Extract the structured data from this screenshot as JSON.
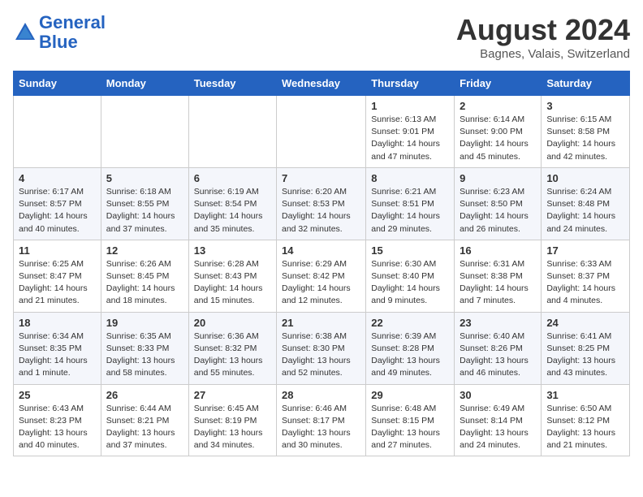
{
  "header": {
    "logo_line1": "General",
    "logo_line2": "Blue",
    "month": "August 2024",
    "location": "Bagnes, Valais, Switzerland"
  },
  "days_of_week": [
    "Sunday",
    "Monday",
    "Tuesday",
    "Wednesday",
    "Thursday",
    "Friday",
    "Saturday"
  ],
  "weeks": [
    [
      {
        "day": "",
        "info": ""
      },
      {
        "day": "",
        "info": ""
      },
      {
        "day": "",
        "info": ""
      },
      {
        "day": "",
        "info": ""
      },
      {
        "day": "1",
        "info": "Sunrise: 6:13 AM\nSunset: 9:01 PM\nDaylight: 14 hours\nand 47 minutes."
      },
      {
        "day": "2",
        "info": "Sunrise: 6:14 AM\nSunset: 9:00 PM\nDaylight: 14 hours\nand 45 minutes."
      },
      {
        "day": "3",
        "info": "Sunrise: 6:15 AM\nSunset: 8:58 PM\nDaylight: 14 hours\nand 42 minutes."
      }
    ],
    [
      {
        "day": "4",
        "info": "Sunrise: 6:17 AM\nSunset: 8:57 PM\nDaylight: 14 hours\nand 40 minutes."
      },
      {
        "day": "5",
        "info": "Sunrise: 6:18 AM\nSunset: 8:55 PM\nDaylight: 14 hours\nand 37 minutes."
      },
      {
        "day": "6",
        "info": "Sunrise: 6:19 AM\nSunset: 8:54 PM\nDaylight: 14 hours\nand 35 minutes."
      },
      {
        "day": "7",
        "info": "Sunrise: 6:20 AM\nSunset: 8:53 PM\nDaylight: 14 hours\nand 32 minutes."
      },
      {
        "day": "8",
        "info": "Sunrise: 6:21 AM\nSunset: 8:51 PM\nDaylight: 14 hours\nand 29 minutes."
      },
      {
        "day": "9",
        "info": "Sunrise: 6:23 AM\nSunset: 8:50 PM\nDaylight: 14 hours\nand 26 minutes."
      },
      {
        "day": "10",
        "info": "Sunrise: 6:24 AM\nSunset: 8:48 PM\nDaylight: 14 hours\nand 24 minutes."
      }
    ],
    [
      {
        "day": "11",
        "info": "Sunrise: 6:25 AM\nSunset: 8:47 PM\nDaylight: 14 hours\nand 21 minutes."
      },
      {
        "day": "12",
        "info": "Sunrise: 6:26 AM\nSunset: 8:45 PM\nDaylight: 14 hours\nand 18 minutes."
      },
      {
        "day": "13",
        "info": "Sunrise: 6:28 AM\nSunset: 8:43 PM\nDaylight: 14 hours\nand 15 minutes."
      },
      {
        "day": "14",
        "info": "Sunrise: 6:29 AM\nSunset: 8:42 PM\nDaylight: 14 hours\nand 12 minutes."
      },
      {
        "day": "15",
        "info": "Sunrise: 6:30 AM\nSunset: 8:40 PM\nDaylight: 14 hours\nand 9 minutes."
      },
      {
        "day": "16",
        "info": "Sunrise: 6:31 AM\nSunset: 8:38 PM\nDaylight: 14 hours\nand 7 minutes."
      },
      {
        "day": "17",
        "info": "Sunrise: 6:33 AM\nSunset: 8:37 PM\nDaylight: 14 hours\nand 4 minutes."
      }
    ],
    [
      {
        "day": "18",
        "info": "Sunrise: 6:34 AM\nSunset: 8:35 PM\nDaylight: 14 hours\nand 1 minute."
      },
      {
        "day": "19",
        "info": "Sunrise: 6:35 AM\nSunset: 8:33 PM\nDaylight: 13 hours\nand 58 minutes."
      },
      {
        "day": "20",
        "info": "Sunrise: 6:36 AM\nSunset: 8:32 PM\nDaylight: 13 hours\nand 55 minutes."
      },
      {
        "day": "21",
        "info": "Sunrise: 6:38 AM\nSunset: 8:30 PM\nDaylight: 13 hours\nand 52 minutes."
      },
      {
        "day": "22",
        "info": "Sunrise: 6:39 AM\nSunset: 8:28 PM\nDaylight: 13 hours\nand 49 minutes."
      },
      {
        "day": "23",
        "info": "Sunrise: 6:40 AM\nSunset: 8:26 PM\nDaylight: 13 hours\nand 46 minutes."
      },
      {
        "day": "24",
        "info": "Sunrise: 6:41 AM\nSunset: 8:25 PM\nDaylight: 13 hours\nand 43 minutes."
      }
    ],
    [
      {
        "day": "25",
        "info": "Sunrise: 6:43 AM\nSunset: 8:23 PM\nDaylight: 13 hours\nand 40 minutes."
      },
      {
        "day": "26",
        "info": "Sunrise: 6:44 AM\nSunset: 8:21 PM\nDaylight: 13 hours\nand 37 minutes."
      },
      {
        "day": "27",
        "info": "Sunrise: 6:45 AM\nSunset: 8:19 PM\nDaylight: 13 hours\nand 34 minutes."
      },
      {
        "day": "28",
        "info": "Sunrise: 6:46 AM\nSunset: 8:17 PM\nDaylight: 13 hours\nand 30 minutes."
      },
      {
        "day": "29",
        "info": "Sunrise: 6:48 AM\nSunset: 8:15 PM\nDaylight: 13 hours\nand 27 minutes."
      },
      {
        "day": "30",
        "info": "Sunrise: 6:49 AM\nSunset: 8:14 PM\nDaylight: 13 hours\nand 24 minutes."
      },
      {
        "day": "31",
        "info": "Sunrise: 6:50 AM\nSunset: 8:12 PM\nDaylight: 13 hours\nand 21 minutes."
      }
    ]
  ]
}
